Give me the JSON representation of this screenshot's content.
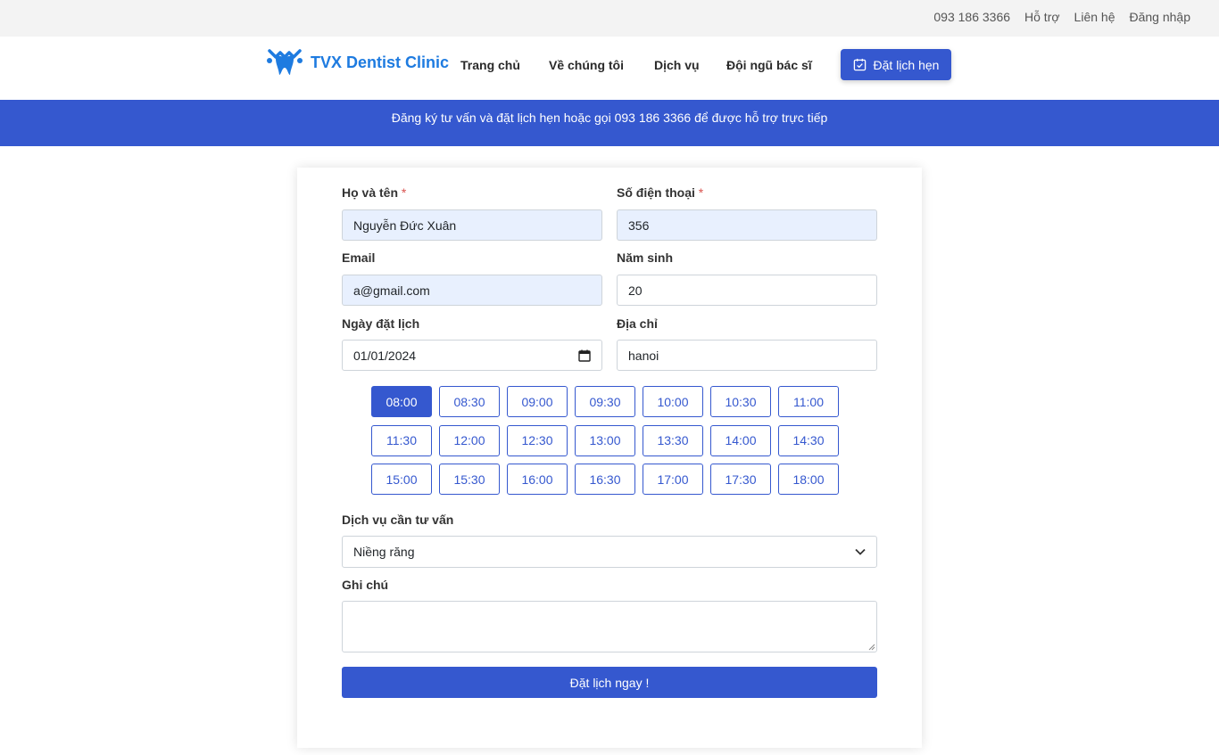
{
  "topbar": {
    "phone": "093 186 3366",
    "support": "Hỗ trợ",
    "contact": "Liên hệ",
    "login": "Đăng nhập"
  },
  "brand": {
    "name": "TVX Dentist Clinic",
    "color": "#1e7be0"
  },
  "nav": {
    "home": "Trang chủ",
    "about": "Về chúng tôi",
    "services": "Dịch vụ",
    "doctors": "Đội ngũ bác sĩ",
    "cta": "Đặt lịch hẹn"
  },
  "banner": {
    "text": "Đăng ký tư vấn và đặt lịch hẹn hoặc gọi 093 186 3366 để được hỗ trợ trực tiếp"
  },
  "form": {
    "fullname_label": "Họ và tên",
    "fullname_value": "Nguyễn Đức Xuân",
    "phone_label": "Số điện thoại",
    "phone_value": "356",
    "email_label": "Email",
    "email_value": "a@gmail.com",
    "birthyear_label": "Năm sinh",
    "birthyear_value": "20",
    "date_label": "Ngày đặt lịch",
    "date_value": "01/01/2024",
    "address_label": "Địa chỉ",
    "address_value": "hanoi",
    "required_mark": "*",
    "time_slots": [
      "08:00",
      "08:30",
      "09:00",
      "09:30",
      "10:00",
      "10:30",
      "11:00",
      "11:30",
      "12:00",
      "12:30",
      "13:00",
      "13:30",
      "14:00",
      "14:30",
      "15:00",
      "15:30",
      "16:00",
      "16:30",
      "17:00",
      "17:30",
      "18:00"
    ],
    "selected_slot": "08:00",
    "service_label": "Dịch vụ cần tư vấn",
    "service_value": "Niềng răng",
    "note_label": "Ghi chú",
    "submit_label": "Đặt lịch ngay !"
  },
  "colors": {
    "primary": "#3558cf",
    "autofill": "#e8f0fe",
    "required": "#d9534f"
  },
  "icons": {
    "logo": "tooth-logo-icon",
    "cta": "calendar-check-icon",
    "date": "calendar-icon",
    "select": "chevron-down-icon"
  }
}
